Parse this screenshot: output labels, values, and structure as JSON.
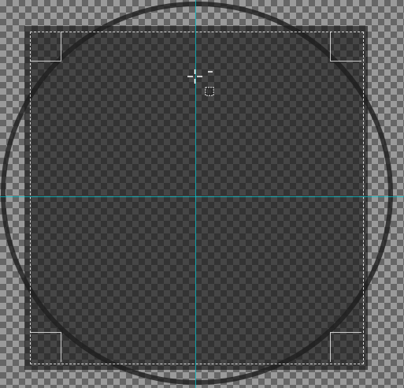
{
  "canvas": {
    "checker_light": "#9a9a9a",
    "checker_dark": "#666666",
    "selection_shade": "#141414",
    "guide_color": "#00c8d2",
    "ellipse_stroke": "#1e1e1e"
  },
  "icons": {
    "corner_handles": "square-corner-handle-icon",
    "cursor": "crosshair-minus-cursor-icon"
  }
}
